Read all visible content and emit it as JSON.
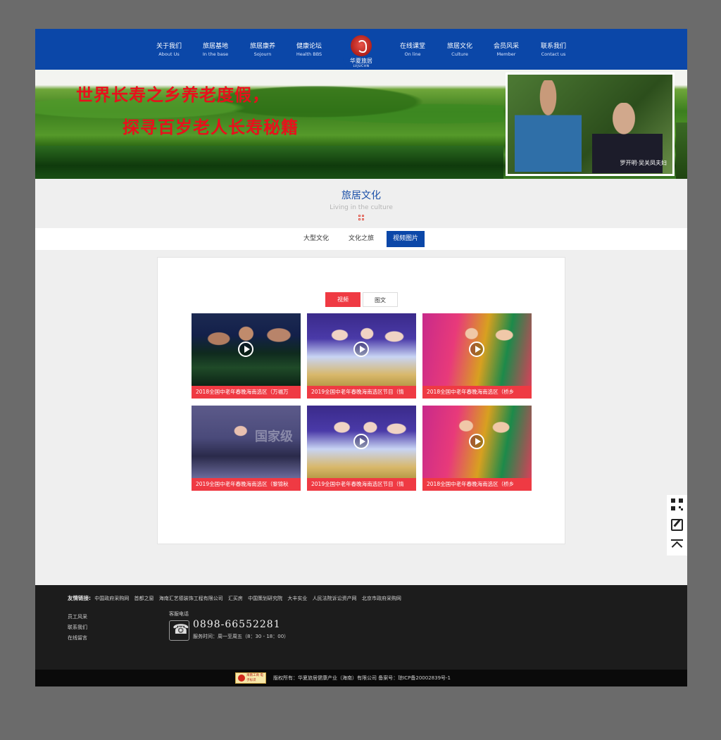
{
  "nav": {
    "items": [
      {
        "cn": "关于我们",
        "en": "About Us"
      },
      {
        "cn": "旅居基地",
        "en": "In the base"
      },
      {
        "cn": "旅居康养",
        "en": "Sojourn"
      },
      {
        "cn": "健康论坛",
        "en": "Health BBS"
      },
      {
        "cn": "在线课堂",
        "en": "On line"
      },
      {
        "cn": "旅居文化",
        "en": "Culture"
      },
      {
        "cn": "会员风采",
        "en": "Member"
      },
      {
        "cn": "联系我们",
        "en": "Contact us"
      }
    ],
    "logo_cn": "华夏旅居",
    "logo_en": "LVJUCHN"
  },
  "banner": {
    "line1": "世界长寿之乡养老度假，",
    "line2": "探寻百岁老人长寿秘籍",
    "photo_caption": "罗开明·吴关凤夫妇"
  },
  "section": {
    "title": "旅居文化",
    "subtitle": "Living in the culture"
  },
  "subnav": {
    "tabs": [
      "大型文化",
      "文化之旅",
      "视频图片"
    ],
    "active": "视频图片"
  },
  "toggle": {
    "video": "视频",
    "text": "图文"
  },
  "videos": [
    {
      "title": "2018全国中老年春晚海南选区（万福万"
    },
    {
      "title": "2019全国中老年春晚海南选区节目（情"
    },
    {
      "title": "2018全国中老年春晚海南选区（桥乡"
    },
    {
      "title": "2019全国中老年春晚海南选区（黎锦秋"
    },
    {
      "title": "2019全国中老年春晚海南选区节目（情"
    },
    {
      "title": "2018全国中老年春晚海南选区（桥乡"
    }
  ],
  "video_overlay_text": "国家级",
  "footer": {
    "links_label": "友情链接:",
    "links": [
      "中国政府采购网",
      "首都之窗",
      "海南汇艺德装饰工程有限公司",
      "汇买房",
      "中国策划研究院",
      "大丰实业",
      "人民法院诉讼资产网",
      "北京市政府采购网"
    ],
    "list": [
      "员工风采",
      "联系我们",
      "在线留言"
    ],
    "cs_label": "客服电话",
    "phone": "0898-66552281",
    "hours": "服务时间：周一至周五（8：30 - 18：00）",
    "badge": "海南工商 电子标识",
    "copyright": "版权所有：华夏旅居健康产业（海南）有限公司 备案号：琼ICP备20002839号-1"
  }
}
